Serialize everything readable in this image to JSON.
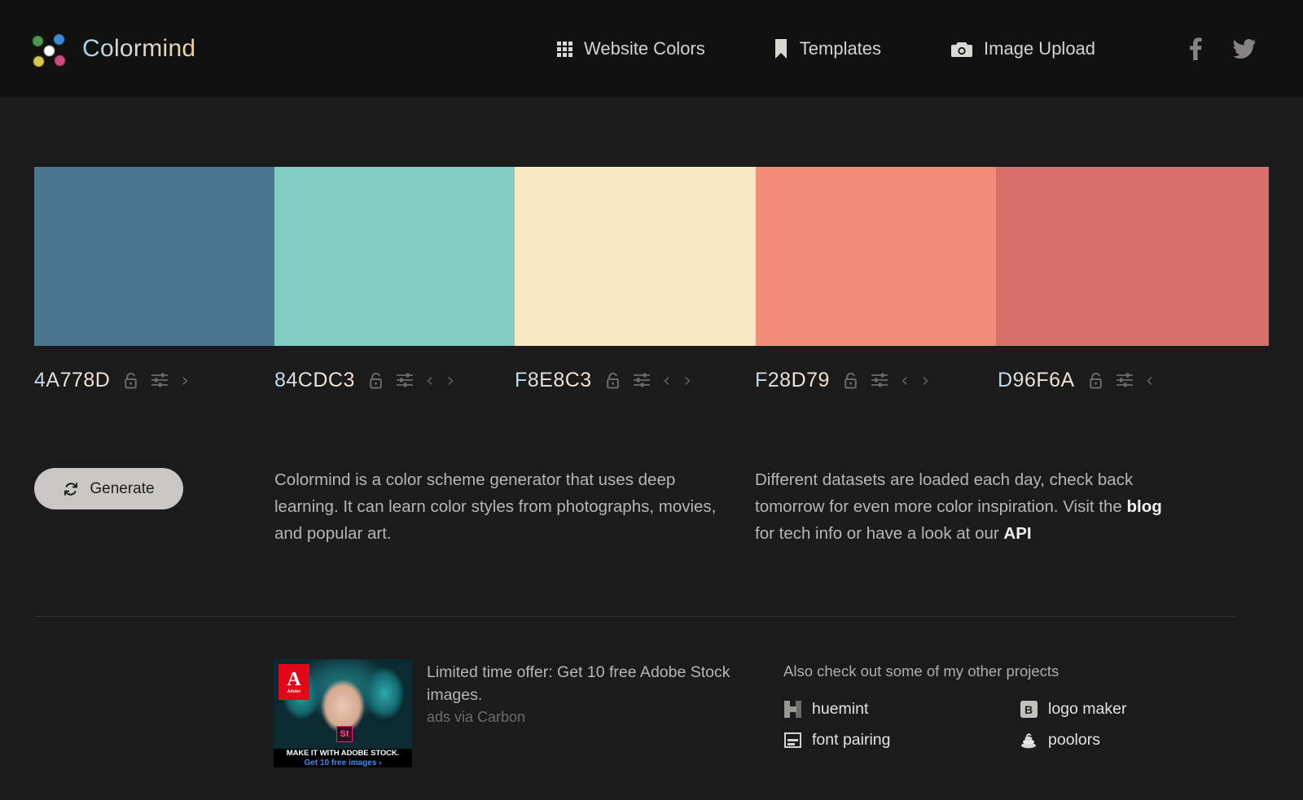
{
  "header": {
    "brand": "Colormind",
    "nav": [
      {
        "label": "Website Colors",
        "icon": "grid-icon"
      },
      {
        "label": "Templates",
        "icon": "bookmark-icon"
      },
      {
        "label": "Image Upload",
        "icon": "camera-icon"
      }
    ],
    "social": [
      {
        "name": "facebook-icon"
      },
      {
        "name": "twitter-icon"
      }
    ]
  },
  "palette": {
    "swatches": [
      {
        "hex": "4A778D",
        "color": "#4A778D",
        "lock": "unlocked",
        "has_prev": false,
        "has_next": true
      },
      {
        "hex": "84CDC3",
        "color": "#84CDC3",
        "lock": "unlocked",
        "has_prev": true,
        "has_next": true
      },
      {
        "hex": "F8E8C3",
        "color": "#F8E8C3",
        "lock": "unlocked",
        "has_prev": true,
        "has_next": true
      },
      {
        "hex": "F28D79",
        "color": "#F28D79",
        "lock": "unlocked",
        "has_prev": true,
        "has_next": true
      },
      {
        "hex": "D96F6A",
        "color": "#D96F6A",
        "lock": "unlocked",
        "has_prev": true,
        "has_next": false
      }
    ]
  },
  "actions": {
    "generate_label": "Generate",
    "generate_icon": "refresh-icon"
  },
  "about": {
    "left_paragraph": "Colormind is a color scheme generator that uses deep learning. It can learn color styles from photographs, movies, and popular art.",
    "right_part_1": "Different datasets are loaded each day, check back tomorrow for even more color inspiration. Visit the ",
    "right_link_blog": "blog",
    "right_part_2": " for tech info or have a look at our ",
    "right_link_api": "API"
  },
  "ad": {
    "headline": "Limited time offer: Get 10 free Adobe Stock images.",
    "attribution": "ads via Carbon",
    "image": {
      "brand": "Adobe",
      "brand_glyph": "A",
      "badge": "St",
      "caption_line1": "MAKE IT WITH ADOBE STOCK.",
      "caption_line2": "Get 10 free images ›"
    }
  },
  "projects": {
    "title": "Also check out some of my other projects",
    "items": [
      {
        "label": "huemint",
        "icon": "huemint-icon"
      },
      {
        "label": "logo maker",
        "icon": "logo-maker-icon",
        "glyph": "B"
      },
      {
        "label": "font pairing",
        "icon": "font-pairing-icon"
      },
      {
        "label": "poolors",
        "icon": "poolors-icon"
      }
    ]
  }
}
